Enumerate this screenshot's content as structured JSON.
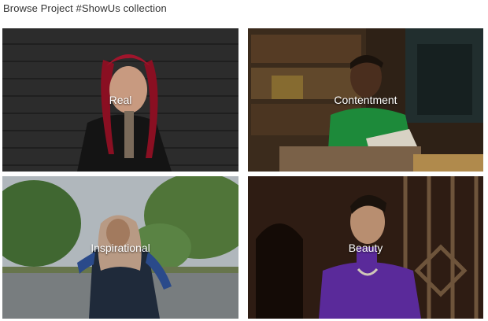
{
  "page": {
    "title": "Browse Project #ShowUs collection"
  },
  "collections": [
    {
      "label": "Real",
      "photo": "woman-red-braids-on-steps"
    },
    {
      "label": "Contentment",
      "photo": "woman-green-sweater-bookstore"
    },
    {
      "label": "Inspirational",
      "photo": "woman-hijab-park-road"
    },
    {
      "label": "Beauty",
      "photo": "woman-purple-turtleneck-doorway"
    }
  ]
}
